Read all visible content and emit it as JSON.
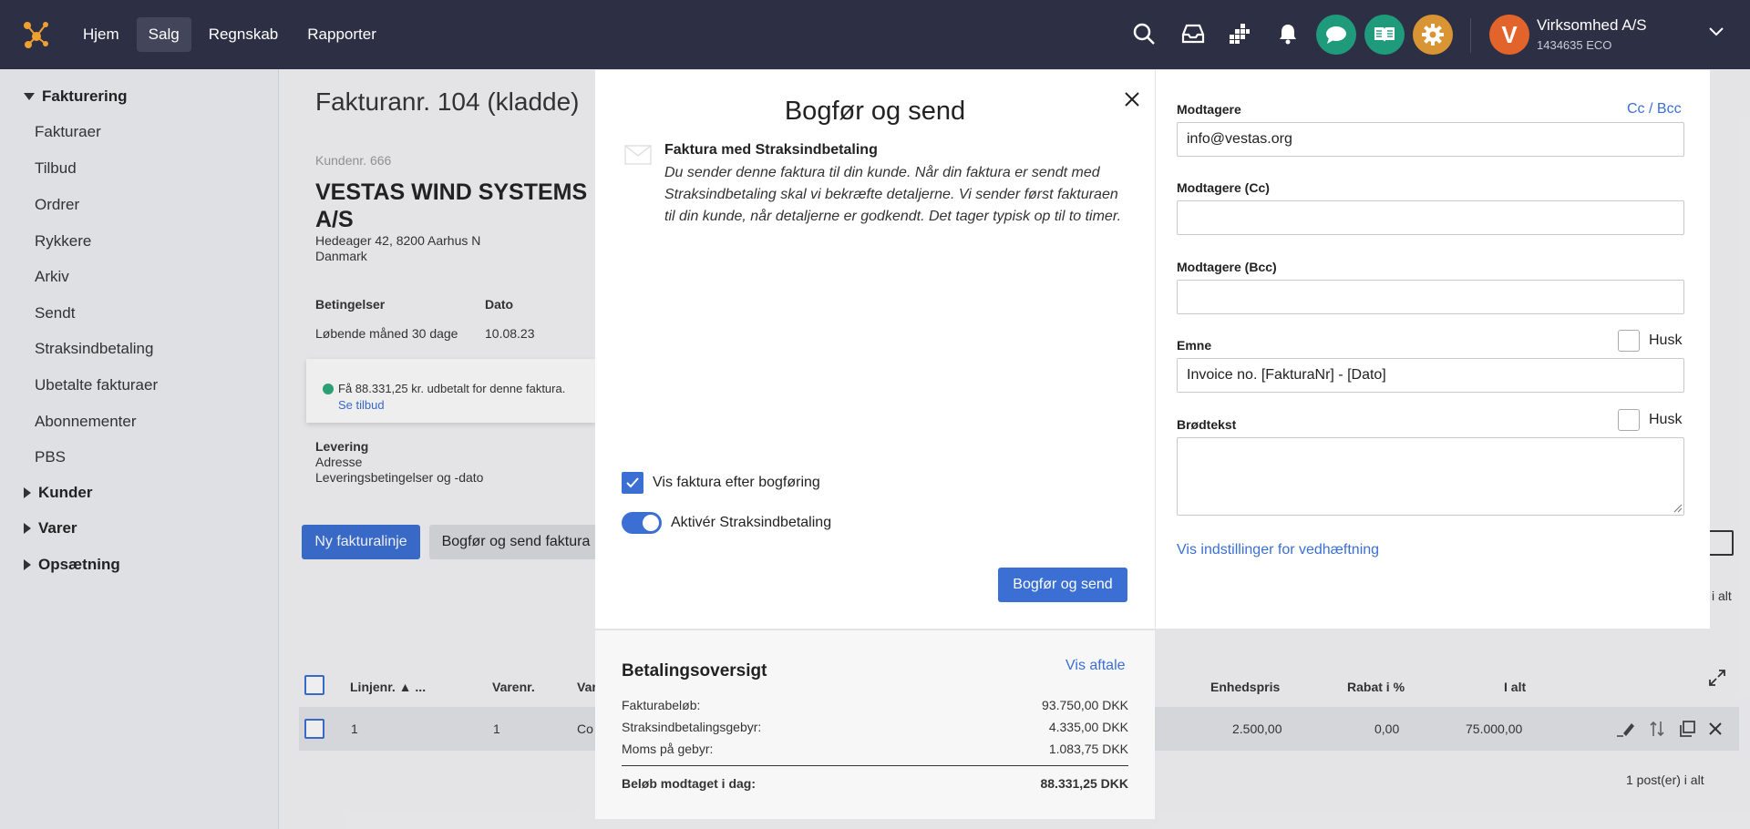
{
  "topbar": {
    "nav": [
      "Hjem",
      "Salg",
      "Regnskab",
      "Rapporter"
    ],
    "active_nav": "Salg",
    "company": {
      "name": "Virksomhed A/S",
      "sub": "1434635 ECO",
      "avatar_letter": "V"
    }
  },
  "sidebar": {
    "sections": [
      {
        "label": "Fakturering",
        "expanded": true,
        "items": [
          "Fakturaer",
          "Tilbud",
          "Ordrer",
          "Rykkere",
          "Arkiv",
          "Sendt",
          "Straksindbetaling",
          "Ubetalte fakturaer",
          "Abonnementer",
          "PBS"
        ]
      },
      {
        "label": "Kunder",
        "expanded": false
      },
      {
        "label": "Varer",
        "expanded": false
      },
      {
        "label": "Opsætning",
        "expanded": false
      }
    ]
  },
  "page": {
    "title": "Fakturanr. 104 (kladde)",
    "customer_nr": "Kundenr. 666",
    "customer_name": "VESTAS WIND SYSTEMS A/S",
    "address_line1": "Hedeager 42, 8200 Aarhus N",
    "address_line2": "Danmark",
    "cond_header": "Betingelser",
    "cond_value": "Løbende måned 30 dage",
    "date_header": "Dato",
    "date_value": "10.08.23",
    "offer_text": "Få 88.331,25 kr. udbetalt for denne faktura.",
    "offer_link": "Se tilbud",
    "delivery_title": "Levering",
    "delivery_line1": "Adresse",
    "delivery_line2": "Leveringsbetingelser og -dato",
    "btn_new_line": "Ny fakturalinje",
    "btn_post_send": "Bogfør og send faktura",
    "total_top": "i alt",
    "table_headers": {
      "line": "Linjenr. ▲ ...",
      "item": "Varenr.",
      "var": "Var",
      "unit_price": "Enhedspris",
      "discount": "Rabat i %",
      "total": "I alt"
    },
    "row": {
      "line": "1",
      "item": "1",
      "var": "Co",
      "unit_price": "2.500,00",
      "discount": "0,00",
      "total": "75.000,00"
    },
    "post_count": "1 post(er) i alt"
  },
  "modal": {
    "title": "Bogfør og send",
    "info_title": "Faktura med Straksindbetaling",
    "info_body": "Du sender denne faktura til din kunde. Når din faktura er sendt med Straksindbetaling skal vi bekræfte detaljerne. Vi sender først fakturaen til din kunde, når detaljerne er godkendt. Det tager typisk op til to timer.",
    "show_invoice_label": "Vis faktura efter bogføring",
    "show_invoice_checked": true,
    "activate_label": "Aktivér Straksindbetaling",
    "activate_on": true,
    "submit_label": "Bogfør og send",
    "payment": {
      "title": "Betalingsoversigt",
      "link": "Vis aftale",
      "rows": [
        {
          "label": "Fakturabeløb:",
          "value": "93.750,00 DKK"
        },
        {
          "label": "Straksindbetalingsgebyr:",
          "value": "4.335,00 DKK"
        },
        {
          "label": "Moms på gebyr:",
          "value": "1.083,75 DKK"
        }
      ],
      "total_label": "Beløb modtaget i dag:",
      "total_value": "88.331,25 DKK"
    },
    "recipients_label": "Modtagere",
    "cc_bcc_link": "Cc / Bcc",
    "recipients_value": "info@vestas.org",
    "cc_label": "Modtagere (Cc)",
    "cc_value": "",
    "bcc_label": "Modtagere (Bcc)",
    "bcc_value": "",
    "subject_label": "Emne",
    "subject_value": "Invoice no. [FakturaNr] - [Dato]",
    "remember_label": "Husk",
    "body_label": "Brødtekst",
    "attach_link": "Vis indstillinger for vedhæftning"
  },
  "colors": {
    "topbar": "#2d3044",
    "accent": "#3b6fd4",
    "avatar": "#e2642b",
    "chat": "#1f9a7a",
    "book": "#1f9a7a",
    "settings": "#d99434"
  }
}
